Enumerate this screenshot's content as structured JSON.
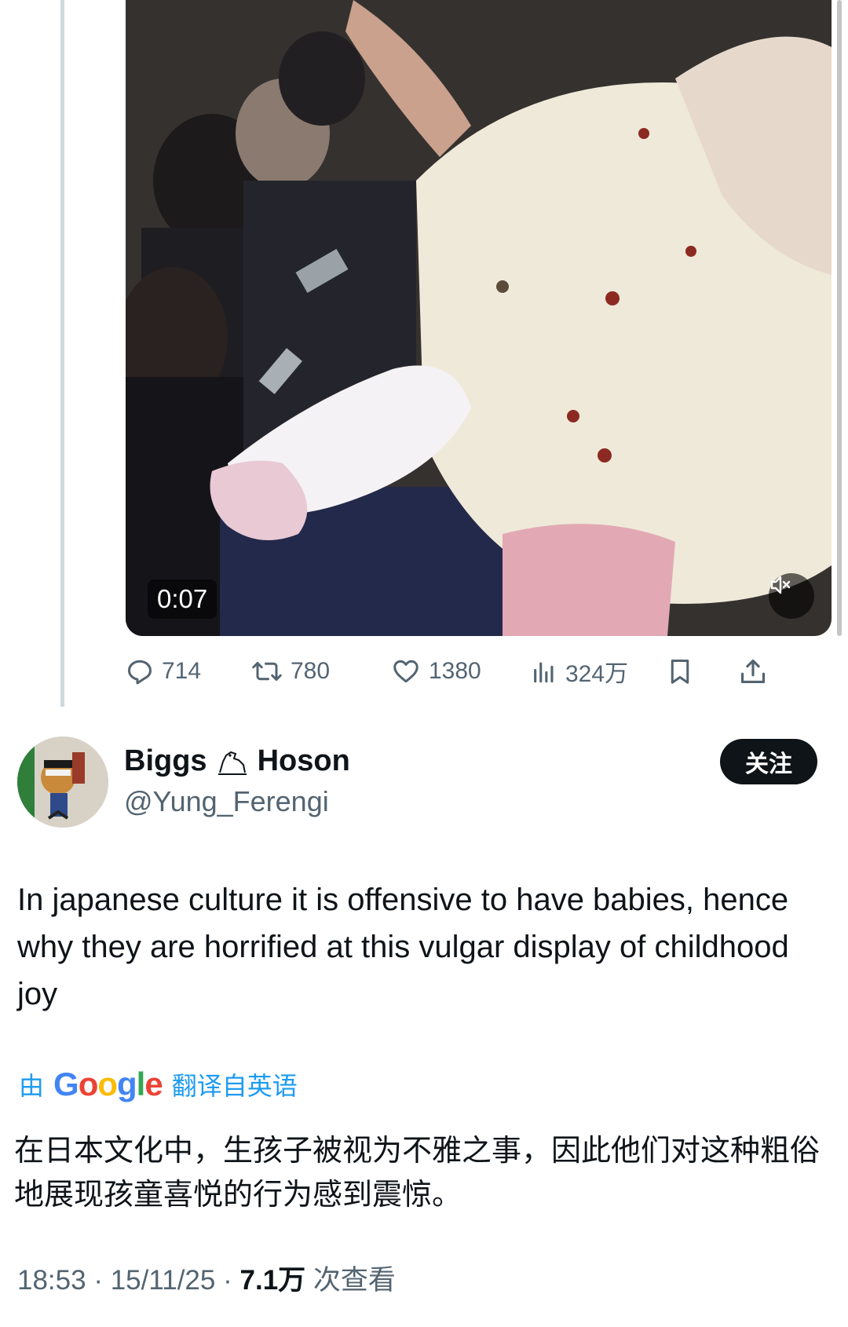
{
  "video": {
    "timestamp": "0:07",
    "mute_icon": "volume-muted-icon"
  },
  "actions": {
    "replies": "714",
    "reposts": "780",
    "likes": "1380",
    "views": "324万"
  },
  "author": {
    "first_name": "Biggs",
    "last_name": "Hoson",
    "handle": "@Yung_Ferengi",
    "follow_label": "关注"
  },
  "tweet": {
    "text": "In japanese culture it is offensive to have babies, hence why they are horrified at this vulgar display of childhood joy"
  },
  "translation": {
    "prefix": "由",
    "suffix": "翻译自英语",
    "text": "在日本文化中，生孩子被视为不雅之事，因此他们对这种粗俗地展现孩童喜悦的行为感到震惊。"
  },
  "meta": {
    "time": "18:53",
    "date": "15/11/25",
    "view_count": "7.1万",
    "view_label": "次查看"
  },
  "colors": {
    "accent": "#1d9bf0",
    "text": "#0f1419",
    "muted": "#536471"
  }
}
